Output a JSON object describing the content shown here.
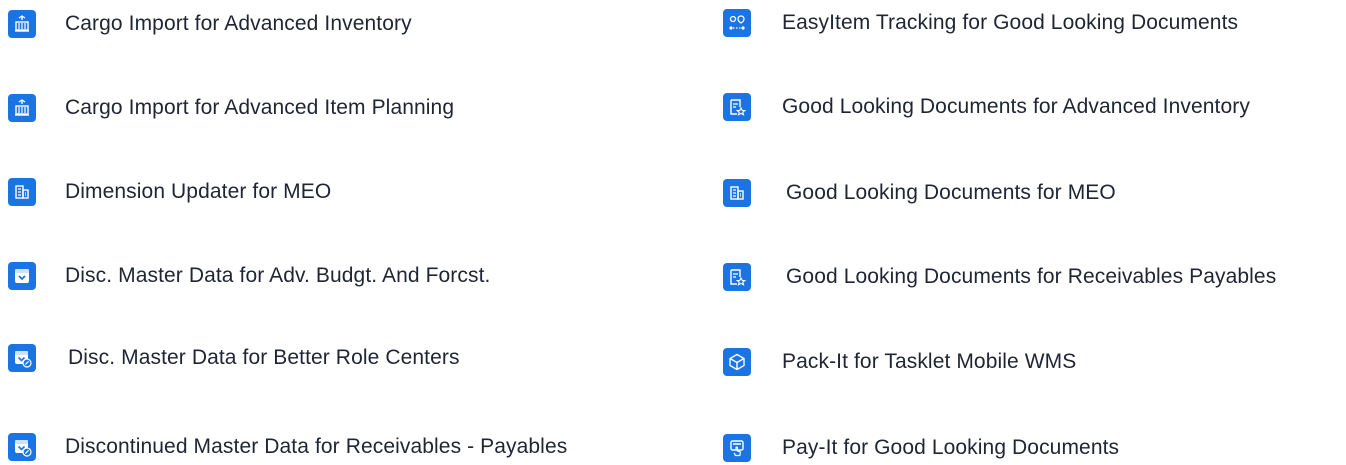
{
  "accent": "#1b74e4",
  "left": [
    {
      "label": "Cargo Import for Advanced Inventory",
      "icon": "cargo-crane-icon"
    },
    {
      "label": "Cargo Import for Advanced Item Planning",
      "icon": "cargo-crane-icon"
    },
    {
      "label": "Dimension Updater for MEO",
      "icon": "building-icon"
    },
    {
      "label": "Disc. Master Data for Adv. Budgt. And Forcst.",
      "icon": "archive-box-icon"
    },
    {
      "label": "Disc. Master Data for Better Role Centers",
      "icon": "archive-link-icon"
    },
    {
      "label": "Discontinued Master Data for Receivables - Payables",
      "icon": "archive-link-icon"
    }
  ],
  "right": [
    {
      "label": "EasyItem Tracking for Good Looking Documents",
      "icon": "tracking-icon"
    },
    {
      "label": "Good Looking Documents for Advanced Inventory",
      "icon": "document-star-icon"
    },
    {
      "label": "Good Looking Documents for MEO",
      "icon": "building-icon"
    },
    {
      "label": "Good Looking Documents for Receivables Payables",
      "icon": "document-star-icon"
    },
    {
      "label": "Pack-It for Tasklet Mobile WMS",
      "icon": "package-icon"
    },
    {
      "label": "Pay-It for Good Looking Documents",
      "icon": "pay-terminal-icon"
    }
  ]
}
